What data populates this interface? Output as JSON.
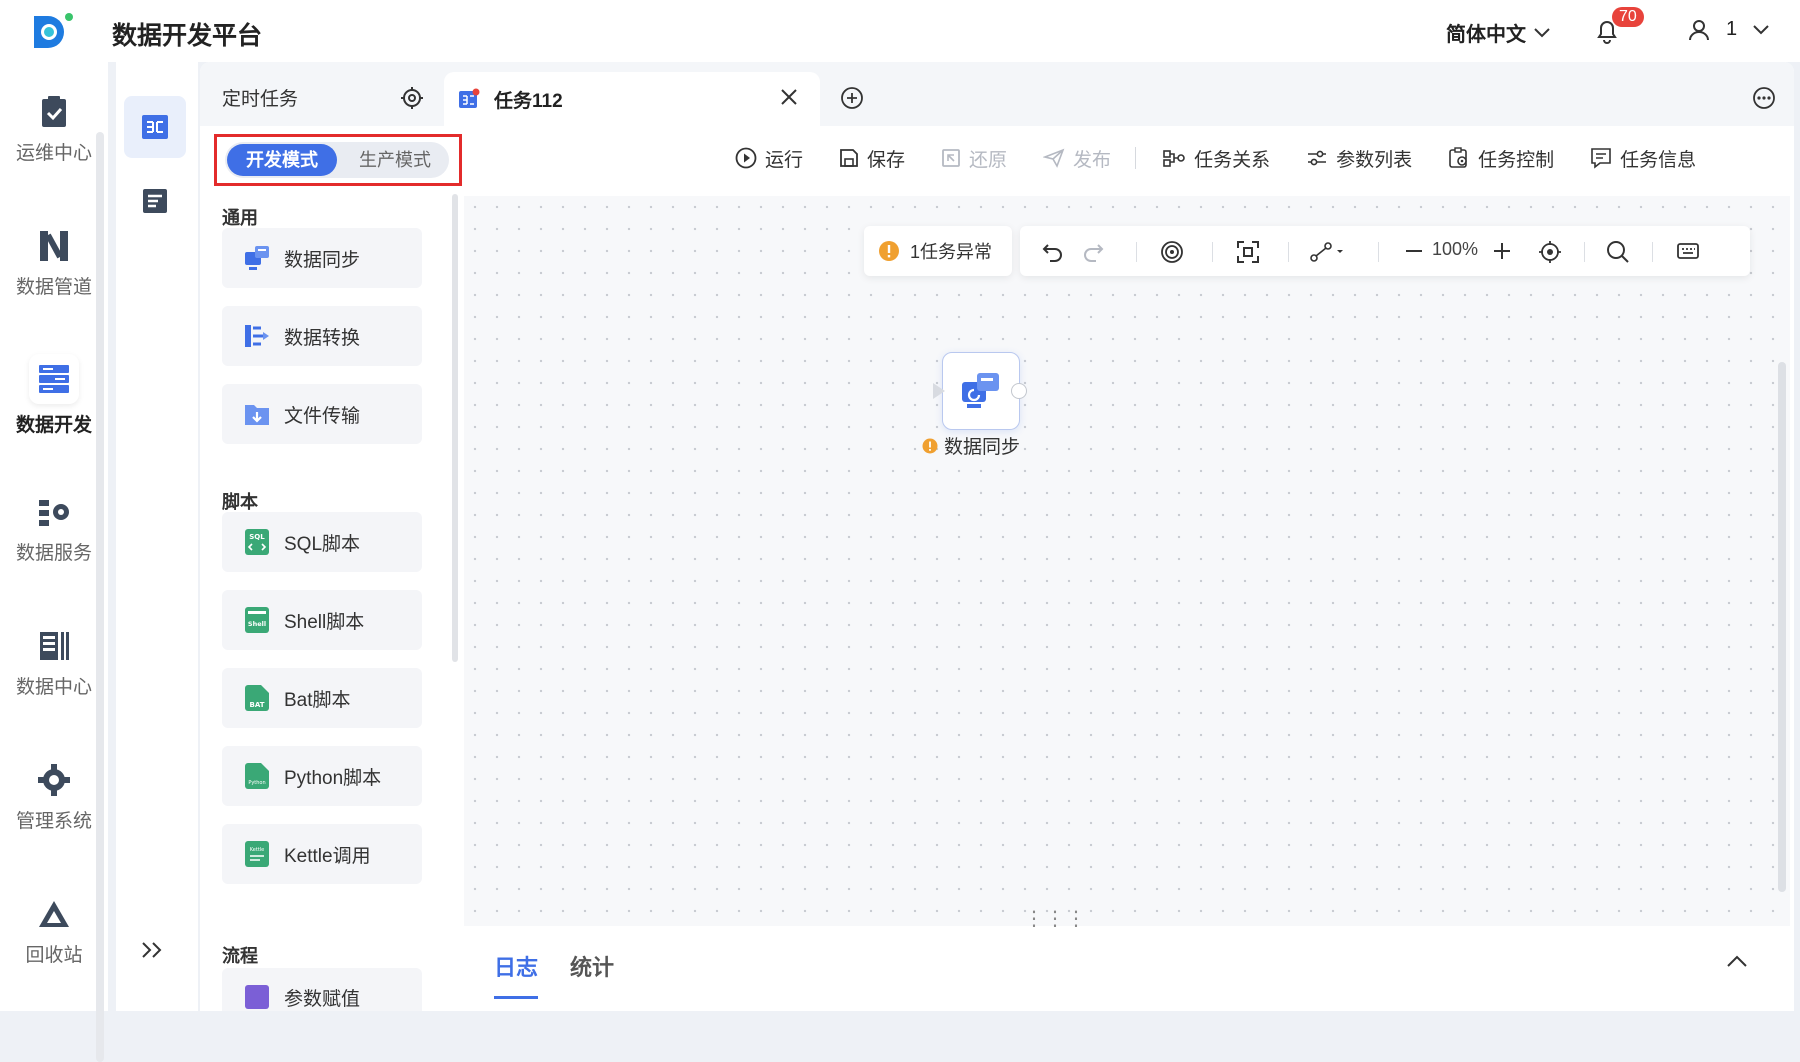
{
  "app": {
    "title": "数据开发平台",
    "language": "简体中文",
    "notification_count": "70",
    "user": "1"
  },
  "nav": {
    "items": [
      {
        "label": "运维中心",
        "icon": "ops-center-icon"
      },
      {
        "label": "数据管道",
        "icon": "data-pipeline-icon"
      },
      {
        "label": "数据开发",
        "icon": "data-dev-icon",
        "active": true
      },
      {
        "label": "数据服务",
        "icon": "data-service-icon"
      },
      {
        "label": "数据中心",
        "icon": "data-center-icon"
      },
      {
        "label": "管理系统",
        "icon": "gear-icon"
      },
      {
        "label": "回收站",
        "icon": "recycle-bin-icon"
      }
    ]
  },
  "tabs": {
    "fixed": "定时任务",
    "active": "任务112"
  },
  "mode": {
    "dev": "开发模式",
    "prod": "生产模式"
  },
  "toolbar": {
    "run": "运行",
    "save": "保存",
    "restore": "还原",
    "publish": "发布",
    "relations": "任务关系",
    "params": "参数列表",
    "control": "任务控制",
    "info": "任务信息"
  },
  "sidebar": {
    "general_title": "通用",
    "general": [
      "数据同步",
      "数据转换",
      "文件传输"
    ],
    "script_title": "脚本",
    "scripts": [
      "SQL脚本",
      "Shell脚本",
      "Bat脚本",
      "Python脚本",
      "Kettle调用"
    ],
    "flow_title": "流程",
    "flow_partial": "参数赋值"
  },
  "canvas": {
    "warning": "1任务异常",
    "zoom": "100%",
    "node_label": "数据同步"
  },
  "bottom": {
    "log_tab": "日志",
    "stats_tab": "统计"
  },
  "colors": {
    "accent": "#3f6fe6",
    "warning": "#f0a030",
    "badge": "#e8433b",
    "highlight_border": "#e32b2b"
  }
}
